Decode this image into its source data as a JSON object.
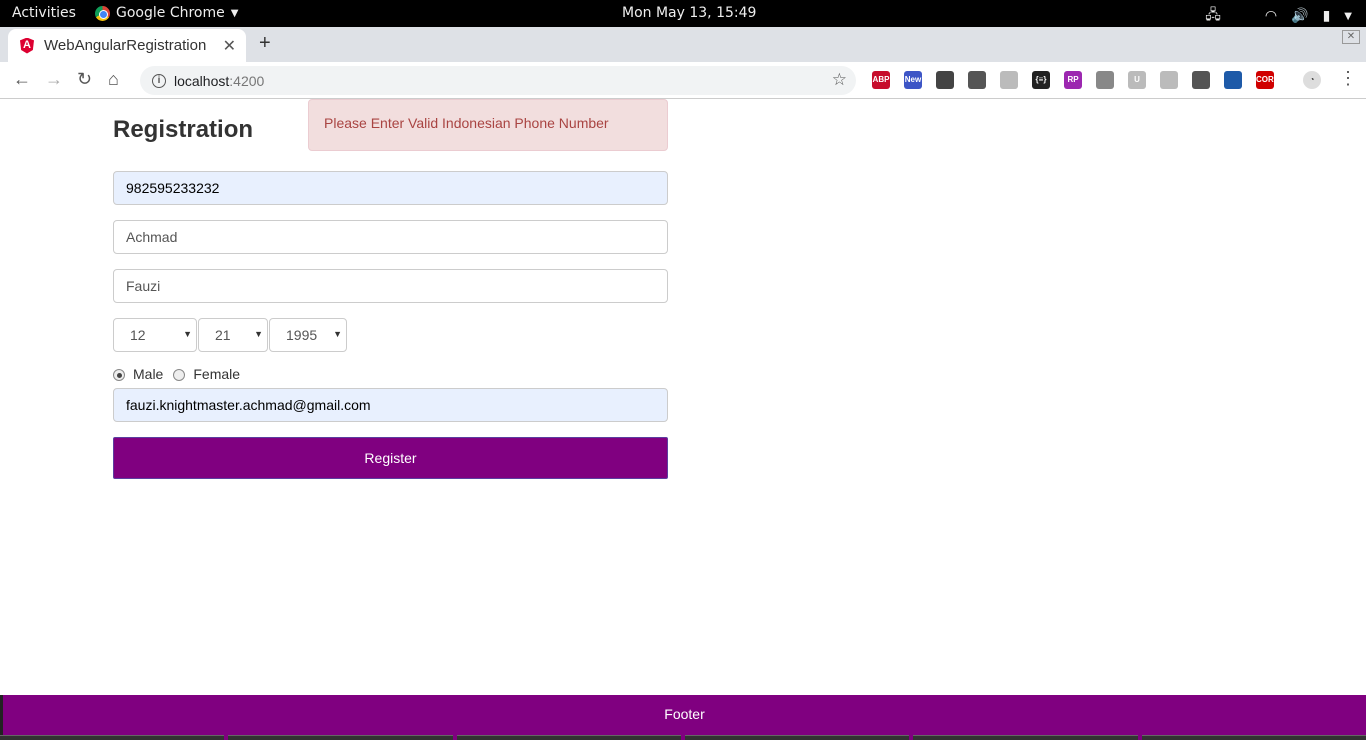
{
  "system": {
    "activities": "Activities",
    "app_name": "Google Chrome",
    "clock": "Mon May 13, 15:49"
  },
  "browser": {
    "tab_title": "WebAngularRegistration",
    "url_host": "localhost",
    "url_port": ":4200",
    "extensions": [
      {
        "name": "abp-icon",
        "label": "ABP",
        "color": "#c70d2c"
      },
      {
        "name": "new-extension-icon",
        "label": "New",
        "color": "#3d55c6"
      },
      {
        "name": "lightbulb-icon",
        "label": "",
        "color": "#444444"
      },
      {
        "name": "sync-icon",
        "label": "",
        "color": "#555555"
      },
      {
        "name": "grid-icon",
        "label": "",
        "color": "#bbbbbb"
      },
      {
        "name": "json-icon",
        "label": "{≡}",
        "color": "#222222"
      },
      {
        "name": "rp-icon",
        "label": "RP",
        "color": "#9c27b0"
      },
      {
        "name": "person-icon",
        "label": "",
        "color": "#888888"
      },
      {
        "name": "u-icon",
        "label": "U",
        "color": "#bbbbbb"
      },
      {
        "name": "camera-icon",
        "label": "",
        "color": "#bbbbbb"
      },
      {
        "name": "brush-icon",
        "label": "",
        "color": "#555555"
      },
      {
        "name": "doc-icon",
        "label": "",
        "color": "#1e5aa8"
      },
      {
        "name": "cors-icon",
        "label": "CORS",
        "color": "#d00000"
      }
    ]
  },
  "form": {
    "title": "Registration",
    "alert": "Please Enter Valid Indonesian Phone Number",
    "phone_value": "982595233232",
    "first_name_value": "Achmad",
    "last_name_value": "Fauzi",
    "dob": {
      "month": "12",
      "day": "21",
      "year": "1995"
    },
    "gender_options": [
      {
        "label": "Male",
        "selected": true
      },
      {
        "label": "Female",
        "selected": false
      }
    ],
    "email_value": "fauzi.knightmaster.achmad@gmail.com",
    "register_label": "Register"
  },
  "footer": {
    "text": "Footer"
  },
  "colors": {
    "accent": "#800080",
    "alert_bg": "#f2dede",
    "alert_text": "#a94442",
    "autofill_bg": "#e8f0fe"
  }
}
